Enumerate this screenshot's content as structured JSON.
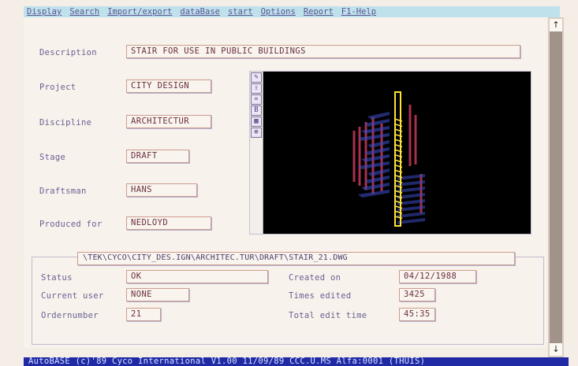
{
  "menu": [
    "Display",
    "Search",
    "Import/export",
    "dataBase",
    "start",
    "Options",
    "Report",
    "F1-Help"
  ],
  "form": {
    "description_label": "Description",
    "description_value": "STAIR FOR USE IN PUBLIC BUILDINGS",
    "project_label": "Project",
    "project_value": "CITY DESIGN",
    "discipline_label": "Discipline",
    "discipline_value": "ARCHITECTUR",
    "stage_label": "Stage",
    "stage_value": "DRAFT",
    "draftsman_label": "Draftsman",
    "draftsman_value": "HANS",
    "produced_label": "Produced for",
    "produced_value": "NEDLOYD"
  },
  "file_path": "\\TEK\\CYCO\\CITY_DES.IGN\\ARCHITEC.TUR\\DRAFT\\STAIR_21.DWG",
  "details": {
    "status_label": "Status",
    "status_value": "OK",
    "user_label": "Current user",
    "user_value": "NONE",
    "order_label": "Ordernumber",
    "order_value": "21",
    "created_label": "Created on",
    "created_value": "04/12/1988",
    "edited_label": "Times edited",
    "edited_value": "3425",
    "edit_time_label": "Total edit time",
    "edit_time_value": "45:35"
  },
  "viewer_tools": [
    "zoom-icon",
    "pan-icon",
    "back-icon",
    "box-icon",
    "grid-icon",
    "view-icon"
  ],
  "viewer_tool_glyphs": [
    "✎",
    "⇧",
    "«",
    "B",
    "▦",
    "⊕"
  ],
  "status_bar": "AutoBASE (c)'89 Cyco International V1.00 11/09/89 CCC.U.MS Alfa:0001 (THUIS)",
  "colors": {
    "menu_bg": "#bfe1ec",
    "status_bg": "#1f2aa4",
    "drawing_red": "#c23a58",
    "drawing_blue": "#3a4ac0",
    "drawing_yellow": "#ffe23a"
  }
}
